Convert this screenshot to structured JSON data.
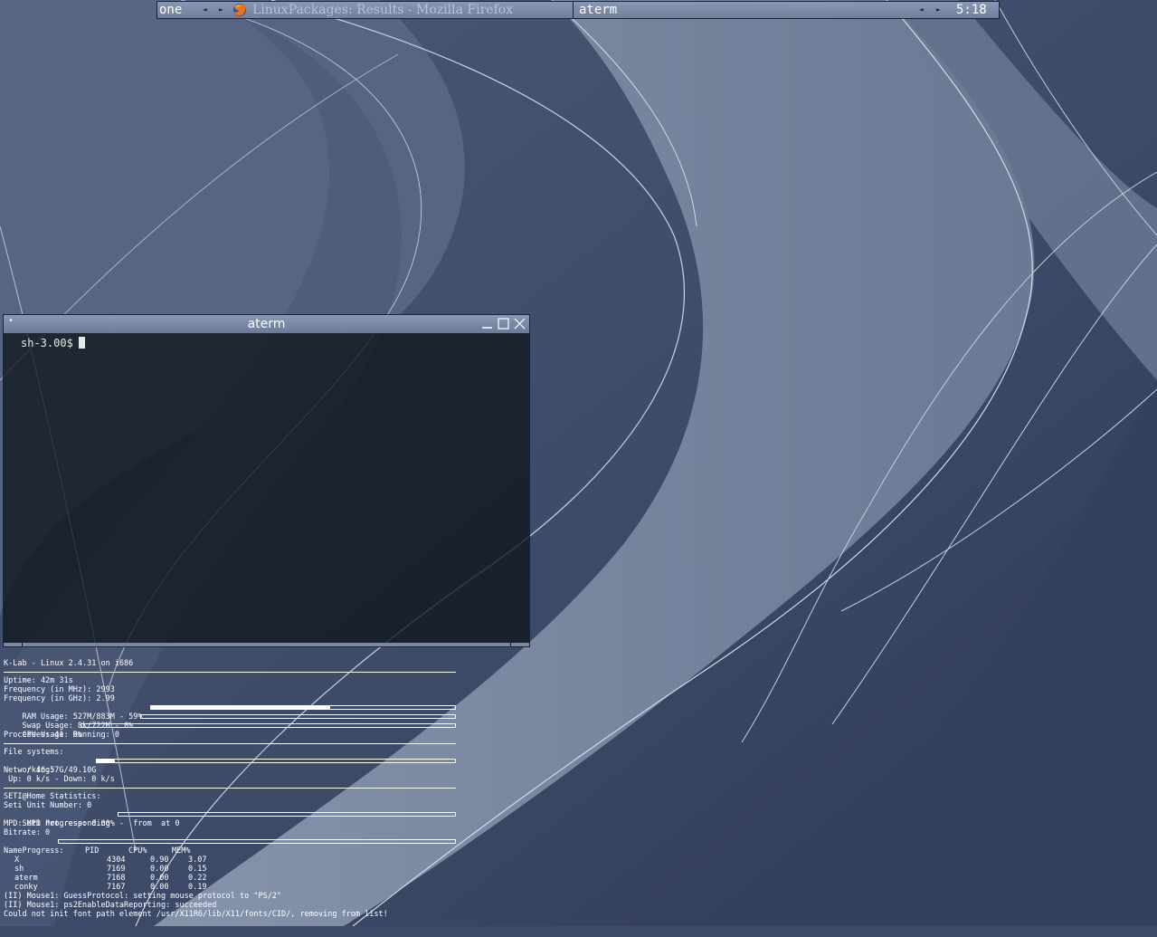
{
  "taskbar": {
    "desktop": "one",
    "prev": "◄",
    "next": "►",
    "firefox_title": "LinuxPackages: Results - Mozilla Firefox",
    "aterm_title": "aterm",
    "clock": "5:18"
  },
  "aterm": {
    "title": "aterm",
    "menu": "•",
    "prompt": "sh-3.00$"
  },
  "conky": {
    "header": "K-Lab - Linux 2.4.31 on i686",
    "uptime": "Uptime: 42m 31s",
    "freq_mhz": "Frequency (in MHz): 2993",
    "freq_ghz": "Frequency (in GHz): 2.99",
    "ram": {
      "label": "RAM Usage: 527M/883M - 59%",
      "percent": 59
    },
    "swap": {
      "label": "Swap Usage: 8k/722M - 0%",
      "percent": 0
    },
    "cpu": {
      "label": "CPU Usage: 0%",
      "percent": 0
    },
    "processes": "Processes: 41  Running: 0",
    "fs_title": "File systems:",
    "fs_root": {
      "label": " / 46.57G/49.10G",
      "percent": 5
    },
    "net_title": "Networking:",
    "net_line": " Up: 0 k/s - Down: 0 k/s",
    "seti_title": "SETI@Home Statistics:",
    "seti_unit": "Seti Unit Number: 0",
    "seti_progress": {
      "label": "Seti Progress: 0.00%",
      "percent": 0
    },
    "mpd": "MPD: MPD not responding  -  from  at 0",
    "bitrate": "Bitrate: 0",
    "progress": {
      "label": "Progress:",
      "percent": 0
    },
    "proc_headers": [
      "Name",
      "PID",
      "CPU%",
      "MEM%"
    ],
    "processes_list": [
      {
        "name": "X",
        "pid": "4304",
        "cpu": "0.90",
        "mem": "3.07"
      },
      {
        "name": "sh",
        "pid": "7169",
        "cpu": "0.00",
        "mem": "0.15"
      },
      {
        "name": "aterm",
        "pid": "7168",
        "cpu": "0.00",
        "mem": "0.22"
      },
      {
        "name": "conky",
        "pid": "7167",
        "cpu": "0.00",
        "mem": "0.19"
      }
    ],
    "log": [
      "(II) Mouse1: GuessProtocol: setting mouse protocol to \"PS/2\"",
      "(II) Mouse1: ps2EnableDataReporting: succeeded",
      "Could not init font path element /usr/X11R6/lib/X11/fonts/CID/, removing from list!"
    ]
  }
}
